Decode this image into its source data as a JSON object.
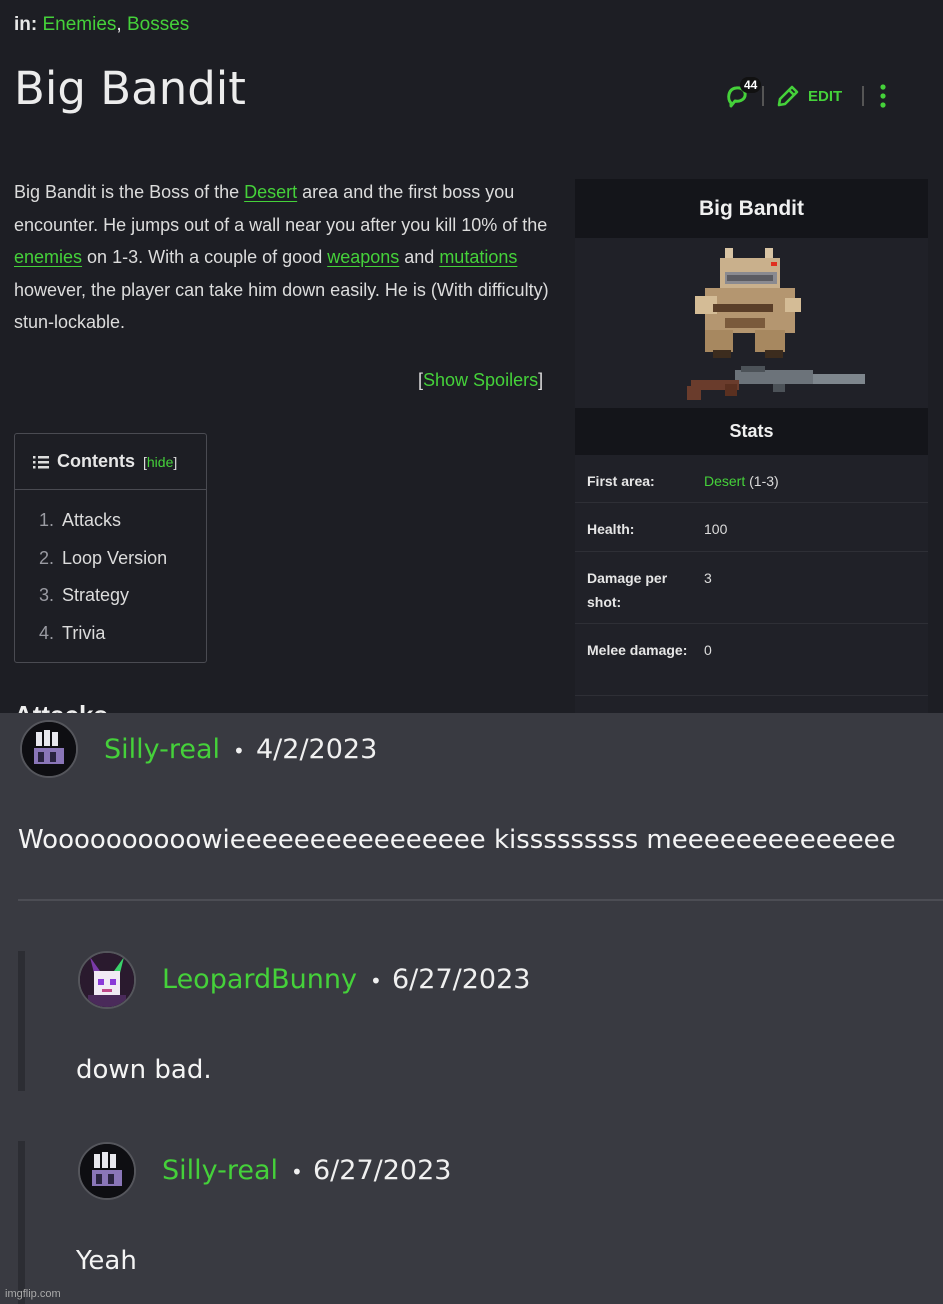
{
  "wiki": {
    "categories_label": "in:",
    "categories": [
      "Enemies",
      "Bosses"
    ],
    "title": "Big Bandit",
    "comment_count": "44",
    "edit_label": "EDIT",
    "intro": {
      "p1": "Big Bandit is the Boss of the ",
      "link1": "Desert",
      "p2": " area and the first boss you encounter. He jumps out of a wall near you after you kill 10% of the ",
      "link2": "enemies",
      "p3": " on 1-3. With a couple of good ",
      "link3": "weapons",
      "p4": " and ",
      "link4": "mutations",
      "p5": " however, the player can take him down easily. He is (With difficulty) stun-lockable."
    },
    "spoilers": {
      "open": "[",
      "label": "Show Spoilers",
      "close": "]"
    },
    "toc": {
      "title": "Contents",
      "hide_open": "[",
      "hide": "hide",
      "hide_close": "]",
      "items": [
        {
          "num": "1.",
          "label": "Attacks"
        },
        {
          "num": "2.",
          "label": "Loop Version"
        },
        {
          "num": "3.",
          "label": "Strategy"
        },
        {
          "num": "4.",
          "label": "Trivia"
        }
      ]
    },
    "cutoff_heading": "Attacks",
    "infobox": {
      "title": "Big Bandit",
      "stats_title": "Stats",
      "rows": [
        {
          "key": "First area:",
          "value_link": "Desert",
          "value": " (1-3)"
        },
        {
          "key": "Health:",
          "value": "100"
        },
        {
          "key": "Damage per shot:",
          "value": "3"
        },
        {
          "key": "Melee damage:",
          "value": "0"
        }
      ]
    }
  },
  "comments": [
    {
      "author": "Silly-real",
      "sep": "•",
      "date": "4/2/2023",
      "text": "Woooooooooowieeeeeeeeeeeeeeee kisssssssss meeeeeeeeeeeeee"
    },
    {
      "author": "LeopardBunny",
      "sep": "•",
      "date": "6/27/2023",
      "text": "down bad."
    },
    {
      "author": "Silly-real",
      "sep": "•",
      "date": "6/27/2023",
      "text": "Yeah"
    }
  ],
  "watermark": "imgflip.com",
  "colors": {
    "accent": "#45d13a",
    "page_bg": "#1d1e24",
    "comments_bg": "#393a41"
  }
}
